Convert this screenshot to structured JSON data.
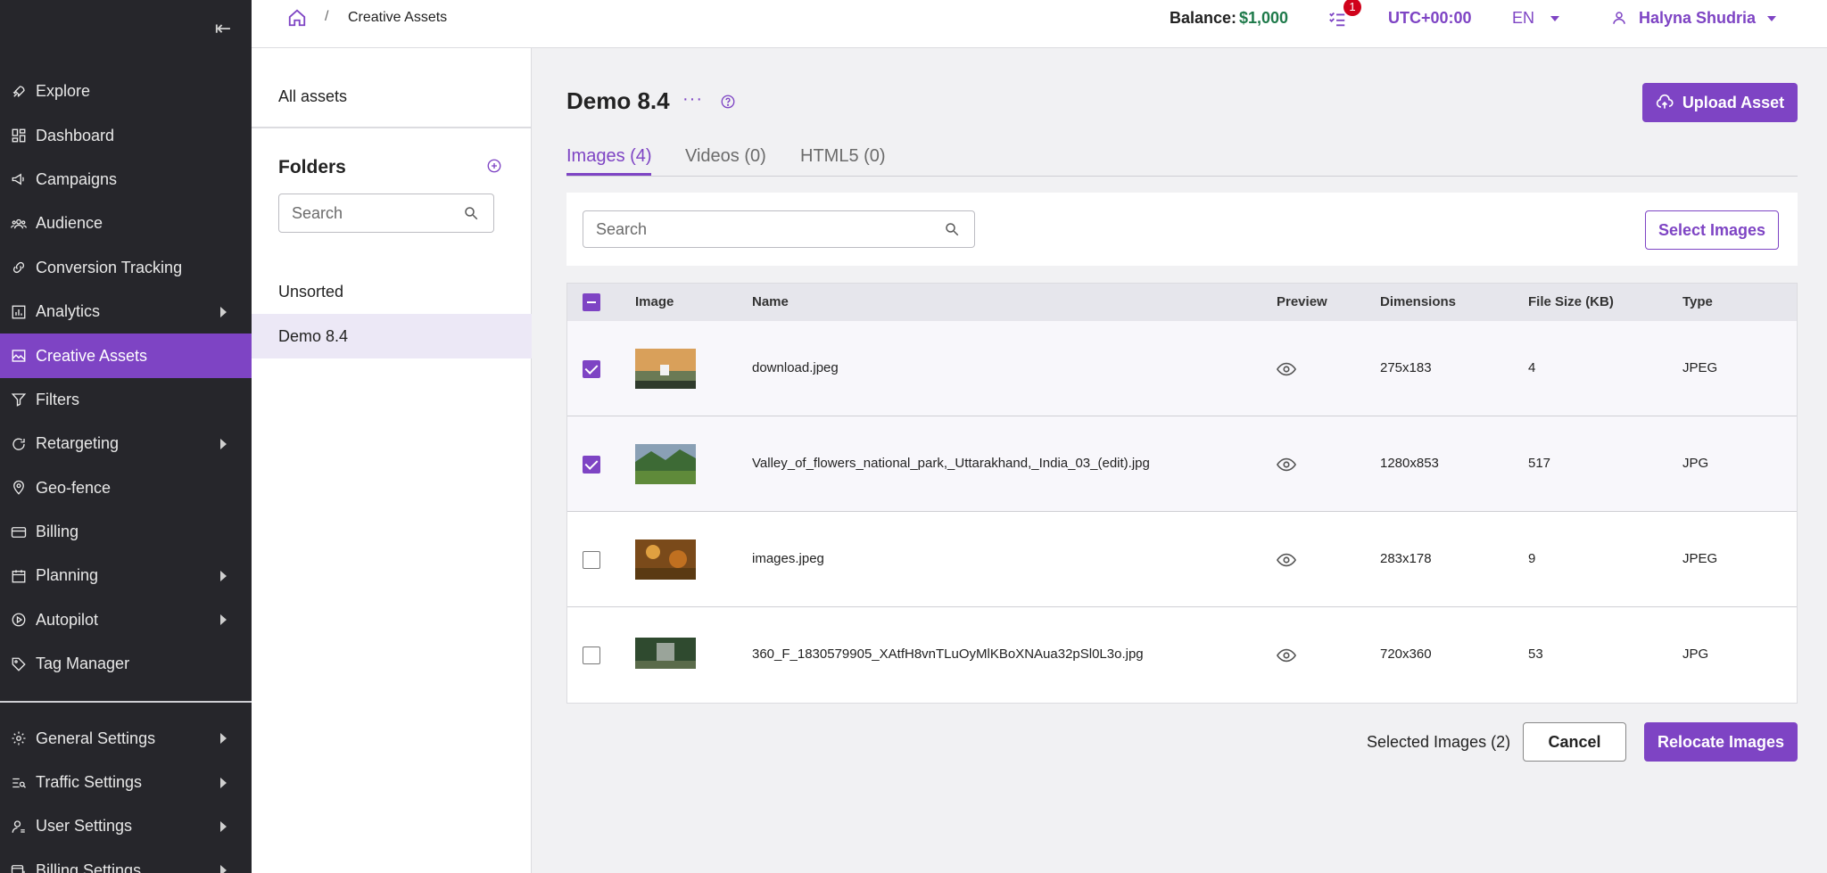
{
  "sidebar": {
    "items": [
      {
        "label": "Explore",
        "icon": "rocket-icon",
        "has_submenu": false
      },
      {
        "label": "Dashboard",
        "icon": "dashboard-icon",
        "has_submenu": false
      },
      {
        "label": "Campaigns",
        "icon": "megaphone-icon",
        "has_submenu": false
      },
      {
        "label": "Audience",
        "icon": "audience-icon",
        "has_submenu": false
      },
      {
        "label": "Conversion Tracking",
        "icon": "link-icon",
        "has_submenu": false
      },
      {
        "label": "Analytics",
        "icon": "bar-chart-icon",
        "has_submenu": true
      },
      {
        "label": "Creative Assets",
        "icon": "image-icon",
        "has_submenu": false,
        "active": true
      },
      {
        "label": "Filters",
        "icon": "filter-icon",
        "has_submenu": false
      },
      {
        "label": "Retargeting",
        "icon": "refresh-icon",
        "has_submenu": true
      },
      {
        "label": "Geo-fence",
        "icon": "location-pin-icon",
        "has_submenu": false
      },
      {
        "label": "Billing",
        "icon": "credit-card-icon",
        "has_submenu": false
      },
      {
        "label": "Planning",
        "icon": "calendar-icon",
        "has_submenu": true
      },
      {
        "label": "Autopilot",
        "icon": "play-circle-icon",
        "has_submenu": true
      },
      {
        "label": "Tag Manager",
        "icon": "tag-icon",
        "has_submenu": false
      }
    ],
    "settings_items": [
      {
        "label": "General Settings",
        "icon": "gear-icon"
      },
      {
        "label": "Traffic Settings",
        "icon": "traffic-icon"
      },
      {
        "label": "User Settings",
        "icon": "user-settings-icon"
      },
      {
        "label": "Billing Settings",
        "icon": "billing-settings-icon"
      }
    ]
  },
  "topbar": {
    "breadcrumb": "Creative Assets",
    "breadcrumb_separator": "/",
    "balance_label": "Balance:",
    "balance_value": "$1,000",
    "tasks_badge": "1",
    "timezone": "UTC+00:00",
    "language": "EN",
    "user_name": "Halyna Shudria"
  },
  "folders": {
    "all_assets": "All assets",
    "title": "Folders",
    "search_placeholder": "Search",
    "items": [
      {
        "label": "Unsorted",
        "selected": false
      },
      {
        "label": "Demo 8.4",
        "selected": true
      }
    ]
  },
  "main": {
    "title": "Demo 8.4",
    "more": "···",
    "upload_label": "Upload Asset",
    "tabs": [
      {
        "label": "Images (4)",
        "active": true
      },
      {
        "label": "Videos (0)",
        "active": false
      },
      {
        "label": "HTML5 (0)",
        "active": false
      }
    ],
    "search_placeholder": "Search",
    "select_label": "Select Images",
    "table": {
      "headers": [
        "Image",
        "Name",
        "Preview",
        "Dimensions",
        "File Size (KB)",
        "Type"
      ],
      "rows": [
        {
          "checked": true,
          "name": "download.jpeg",
          "dimensions": "275x183",
          "size": "4",
          "type": "JPEG",
          "thumb_colors": [
            "#d9a05a",
            "#6a7a55",
            "#2f3a2c"
          ]
        },
        {
          "checked": true,
          "name": "Valley_of_flowers_national_park,_Uttarakhand,_India_03_(edit).jpg",
          "dimensions": "1280x853",
          "size": "517",
          "type": "JPG",
          "thumb_colors": [
            "#8aa0b5",
            "#3d6a35",
            "#5f8a3a"
          ]
        },
        {
          "checked": false,
          "name": "images.jpeg",
          "dimensions": "283x178",
          "size": "9",
          "type": "JPEG",
          "thumb_colors": [
            "#7a4a1a",
            "#e0a040",
            "#c07020"
          ]
        },
        {
          "checked": false,
          "name": "360_F_1830579905_XAtfH8vnTLuOyMlKBoXNAua32pSl0L3o.jpg",
          "dimensions": "720x360",
          "size": "53",
          "type": "JPG",
          "thumb_colors": [
            "#2f4a2f",
            "#9aa49a",
            "#5a6b4a"
          ]
        }
      ]
    },
    "selected_label": "Selected Images (2)",
    "cancel_label": "Cancel",
    "relocate_label": "Relocate Images"
  }
}
